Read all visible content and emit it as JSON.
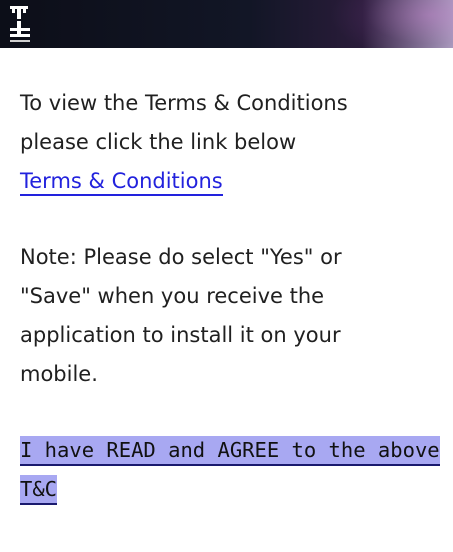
{
  "status_bar": {
    "signal_icon": "signal-strength-icon",
    "colors": {
      "dark": "#0c0e18",
      "accent": "#2a1c3a"
    }
  },
  "intro": {
    "line1": "To view the Terms & Conditions",
    "line2": "please click the link below",
    "link_label": "Terms & Conditions"
  },
  "note": {
    "line1": "Note: Please do select \"Yes\" or",
    "line2": "\"Save\" when you receive the",
    "line3": "application to install it on your",
    "line4": "mobile."
  },
  "agree": {
    "line1": "I have READ and AGREE to the above",
    "line2": "T&C"
  },
  "colors": {
    "link": "#2222dd",
    "agree_highlight": "#a8a8f2"
  }
}
